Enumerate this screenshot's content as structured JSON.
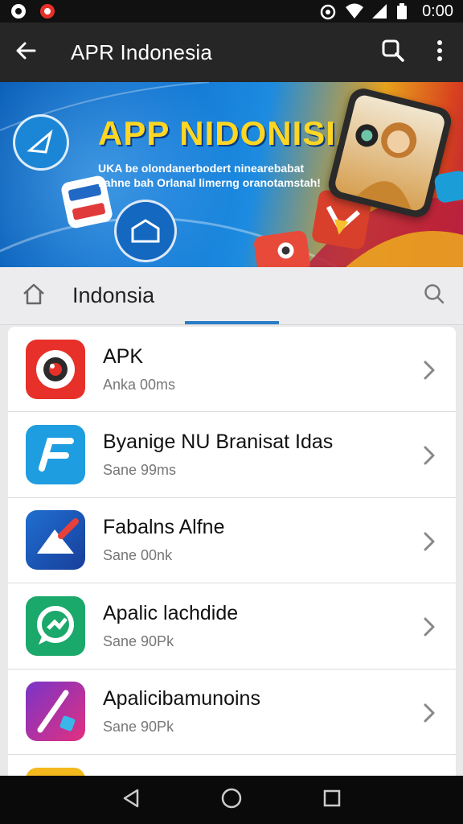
{
  "status_bar": {
    "time": "0:00",
    "left_icons": [
      "notification-icon",
      "app-notification-icon"
    ],
    "right_icons": [
      "alarm-icon",
      "wifi-icon",
      "signal-icon",
      "battery-icon"
    ]
  },
  "app_bar": {
    "title": "APR Indonesia",
    "back_icon": "arrow-left-icon",
    "search_icon": "search-icon",
    "menu_icon": "more-vert-icon",
    "background": "#262626"
  },
  "banner": {
    "title": "APP NIDONISIA",
    "tagline": "UKA be olondanerbodert ninearebabat llahne bah Orlanal limerng oranotamstah!"
  },
  "search_row": {
    "label": "Indonsia",
    "home_icon": "home-icon",
    "search_icon": "search-icon",
    "accent": "#2a7cc7"
  },
  "apps": [
    {
      "name": "APK",
      "subtitle": "Anka 00ms",
      "icon": "camera-lens-icon",
      "color": "#e8302a"
    },
    {
      "name": "Byanige NU Branisat Idas",
      "subtitle": "Sane 99ms",
      "icon": "f-logo-icon",
      "color": "#1e9de0"
    },
    {
      "name": "Fabalns Alfne",
      "subtitle": "Sane 00nk",
      "icon": "paper-plane-icon",
      "color": "#1f6fd1"
    },
    {
      "name": "Apalic lachdide",
      "subtitle": "Sane 90Pk",
      "icon": "chat-bubble-icon",
      "color": "#1aa86b"
    },
    {
      "name": "Apalicibamunoins",
      "subtitle": "Sane 90Pk",
      "icon": "pen-icon",
      "color": "#c2308f"
    }
  ],
  "nav_bar": {
    "back_icon": "nav-back-icon",
    "home_icon": "nav-home-icon",
    "recents_icon": "nav-recents-icon"
  }
}
